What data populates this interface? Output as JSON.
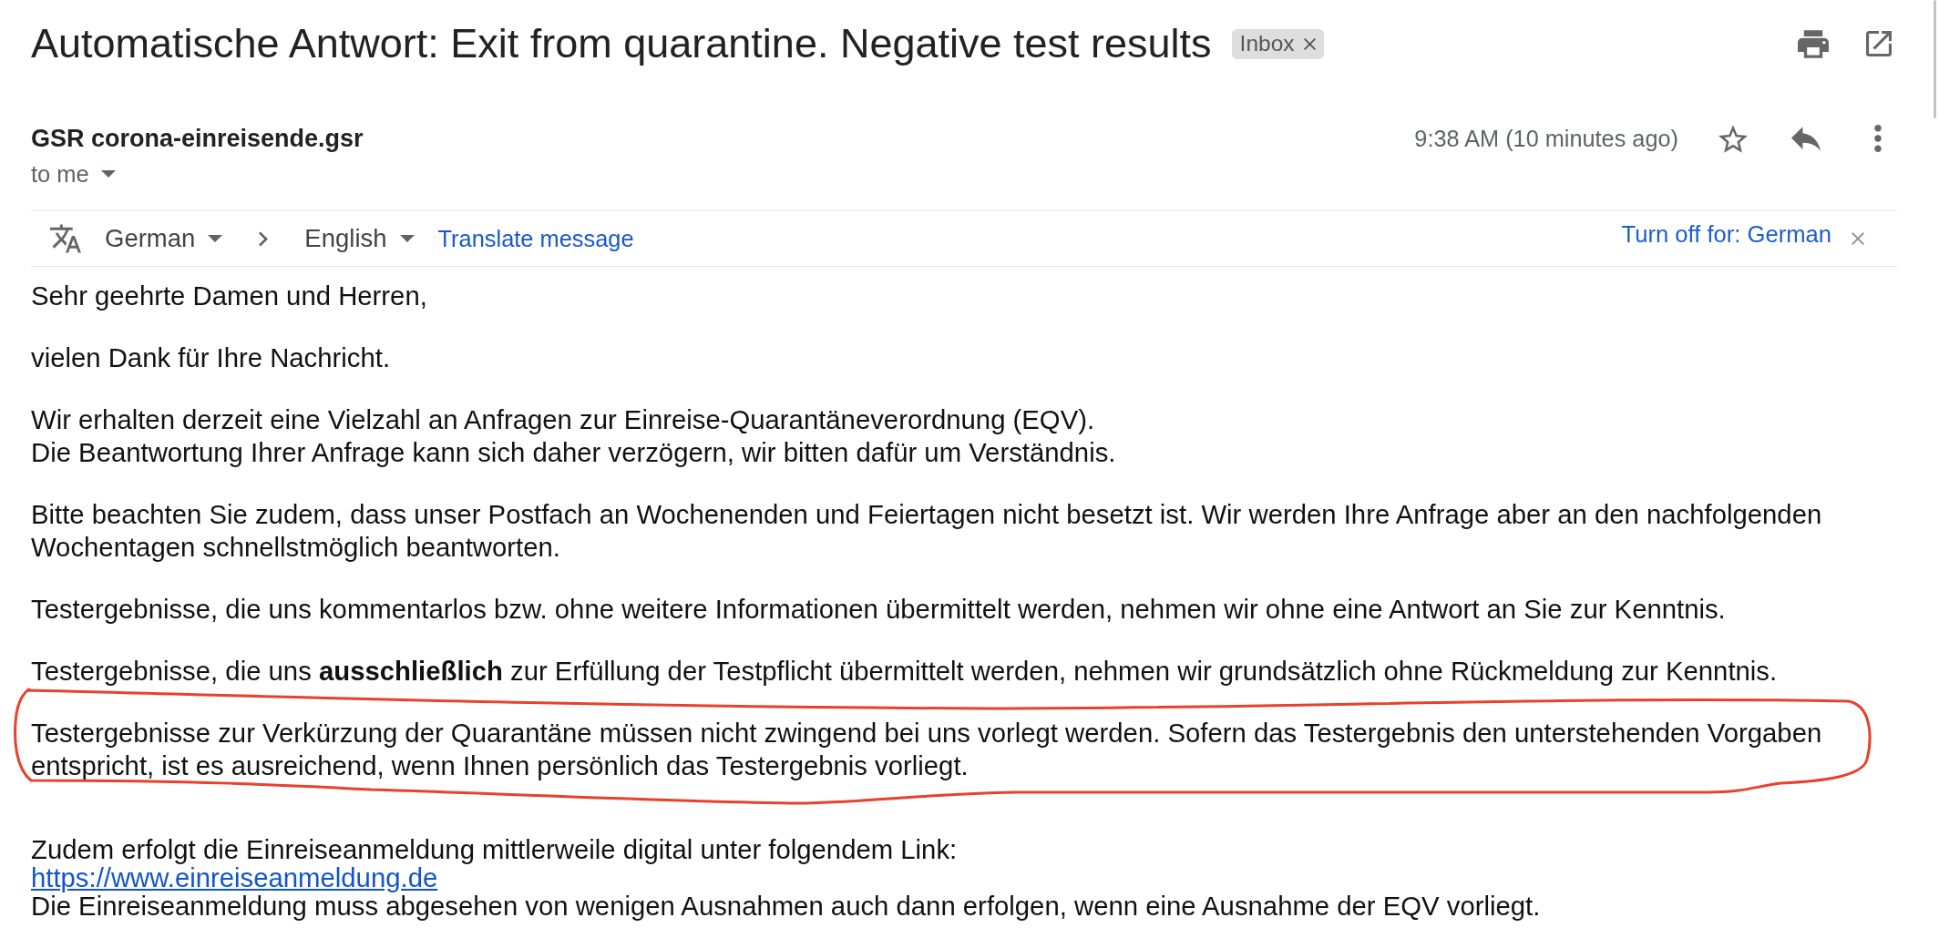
{
  "header": {
    "subject": "Automatische Antwort: Exit from quarantine. Negative test results",
    "labels": [
      {
        "text": "Inbox"
      }
    ]
  },
  "message": {
    "sender": "GSR corona-einreisende.gsr",
    "recipient": "to me",
    "time": "9:38 AM (10 minutes ago)",
    "starred": false
  },
  "translate_bar": {
    "source_language": "German",
    "target_language": "English",
    "action": "Translate message",
    "turn_off": "Turn off for: German"
  },
  "body": {
    "paragraphs": [
      {
        "lines": [
          "Sehr geehrte Damen und Herren,"
        ],
        "circled": false
      },
      {
        "lines": [
          "vielen Dank für Ihre Nachricht."
        ],
        "circled": false
      },
      {
        "lines": [
          "Wir erhalten derzeit eine Vielzahl an Anfragen zur Einreise-Quarantäneverordnung (EQV).",
          "Die Beantwortung Ihrer Anfrage kann sich daher verzögern, wir bitten dafür um Verständnis."
        ],
        "circled": false
      },
      {
        "lines": [
          "Bitte beachten Sie zudem, dass unser Postfach an Wochenenden und Feiertagen nicht besetzt ist. Wir werden Ihre Anfrage aber an den nachfolgenden Wochentagen schnellstmöglich beantworten."
        ],
        "circled": false
      },
      {
        "lines": [
          "Testergebnisse, die uns kommentarlos bzw. ohne weitere Informationen übermittelt werden, nehmen wir ohne eine Antwort an Sie zur Kenntnis."
        ],
        "circled": false
      },
      {
        "lines": [
          "Testergebnisse, die uns **ausschließlich** zur Erfüllung der Testpflicht übermittelt werden, nehmen wir grundsätzlich ohne Rückmeldung zur Kenntnis."
        ],
        "circled": false
      },
      {
        "lines": [
          "Testergebnisse zur Verkürzung der Quarantäne müssen nicht zwingend bei uns vorlegt werden. Sofern das Testergebnis den unterstehenden Vorgaben entspricht, ist es ausreichend, wenn Ihnen persönlich das Testergebnis vorliegt."
        ],
        "circled": true
      }
    ],
    "link_block": {
      "intro": "Zudem erfolgt die Einreiseanmeldung mittlerweile digital unter folgendem Link:",
      "link": "https://www.einreiseanmeldung.de",
      "note": "Die Einreiseanmeldung muss abgesehen von wenigen Ausnahmen auch dann erfolgen, wenn eine Ausnahme der EQV vorliegt."
    }
  }
}
